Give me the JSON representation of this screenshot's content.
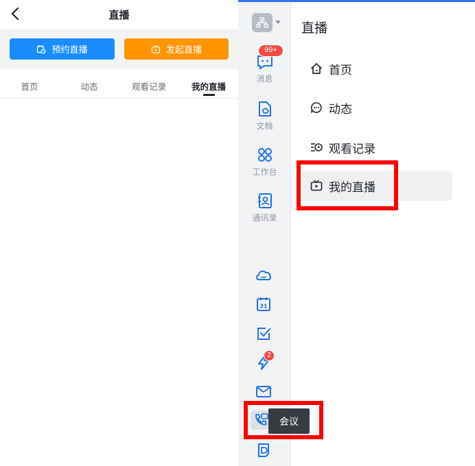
{
  "mobile": {
    "title": "直播",
    "actions": {
      "schedule_label": "预约直播",
      "start_label": "发起直播",
      "schedule_color": "#1a8cff",
      "start_color": "#ff9500"
    },
    "tabs": [
      {
        "label": "首页"
      },
      {
        "label": "动态"
      },
      {
        "label": "观看记录"
      },
      {
        "label": "我的直播",
        "active": true
      }
    ]
  },
  "desktop": {
    "accent_color": "#3370ff",
    "rail": {
      "items": [
        {
          "label": "消息",
          "icon": "message-icon",
          "badge": "99+"
        },
        {
          "label": "文档",
          "icon": "docs-icon"
        },
        {
          "label": "工作台",
          "icon": "workplace-icon"
        },
        {
          "label": "通讯录",
          "icon": "contacts-icon"
        }
      ],
      "bottom_icons": [
        {
          "icon": "cloud-face-icon"
        },
        {
          "icon": "calendar-icon",
          "text": "31"
        },
        {
          "icon": "checkbox-icon"
        },
        {
          "icon": "lightning-icon",
          "badge": "2"
        },
        {
          "icon": "mail-icon"
        },
        {
          "icon": "phone-video-icon"
        },
        {
          "icon": "d-app-icon"
        }
      ]
    },
    "tooltip": "会议",
    "panel": {
      "title": "直播",
      "nav": [
        {
          "label": "首页",
          "icon": "home-icon"
        },
        {
          "label": "动态",
          "icon": "chat-bubble-icon"
        },
        {
          "label": "观看记录",
          "icon": "history-icon"
        },
        {
          "label": "我的直播",
          "icon": "tv-icon",
          "active": true
        }
      ]
    },
    "highlight_color": "#ff0000"
  }
}
